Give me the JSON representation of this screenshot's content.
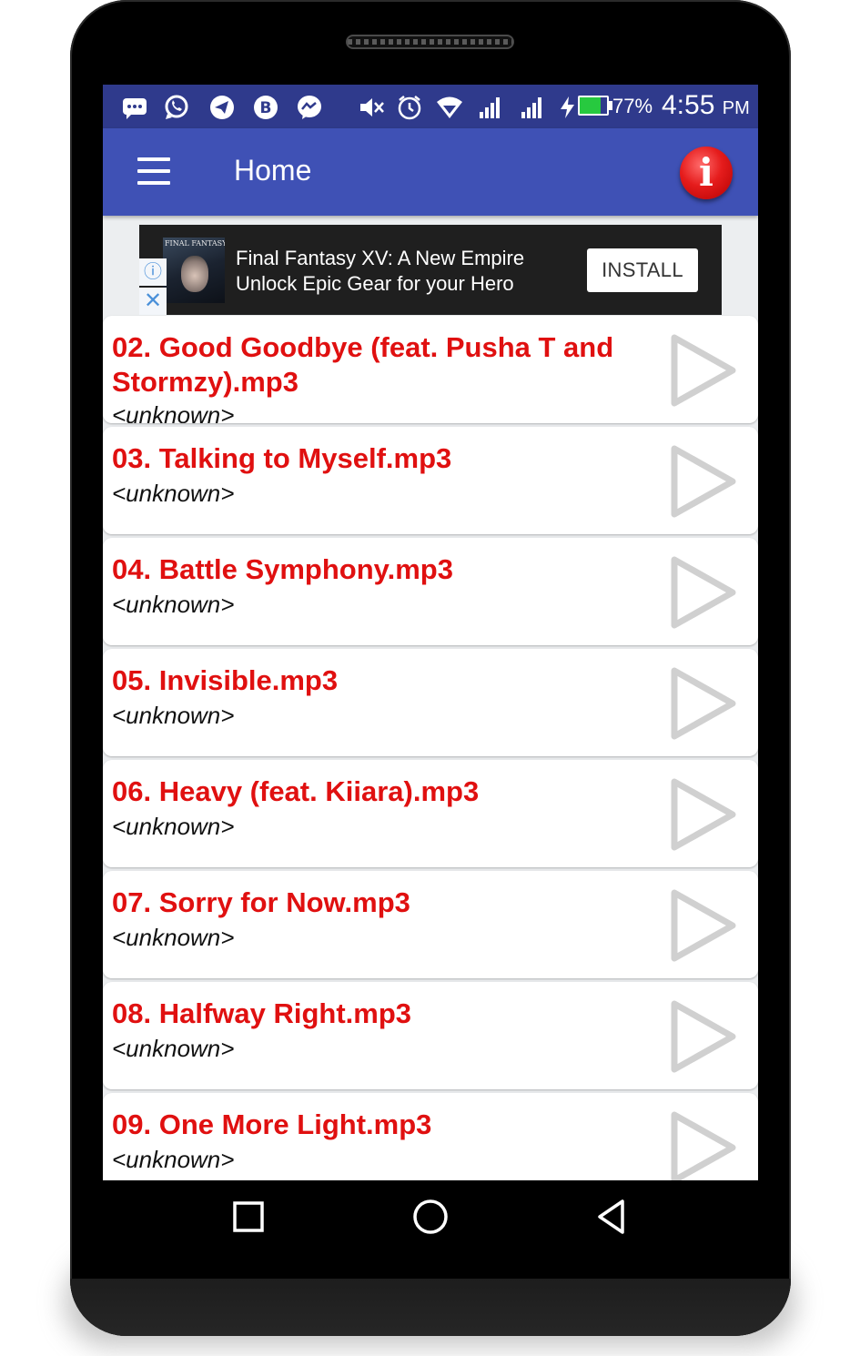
{
  "status_bar": {
    "icons": [
      "messaging-icon",
      "whatsapp-icon",
      "telegram-icon",
      "bbm-icon",
      "messenger-icon",
      "mute-icon",
      "alarm-icon",
      "wifi-icon",
      "signal-icon",
      "signal-icon",
      "charging-icon",
      "battery-icon"
    ],
    "battery_percent": "77%",
    "battery_level": 0.77,
    "time": "4:55",
    "ampm": "PM"
  },
  "app_bar": {
    "title": "Home",
    "menu_icon": "hamburger-menu-icon",
    "info_icon": "info-icon",
    "info_glyph": "i",
    "accent_color": "#3f51b5",
    "status_color": "#2f3a8c"
  },
  "ad": {
    "thumb_title": "FINAL FANTASY XV",
    "line1": "Final Fantasy XV: A New Empire",
    "line2": "Unlock Epic Gear for your Hero",
    "install_label": "INSTALL",
    "info_glyph": "ⓘ",
    "close_glyph": "✕"
  },
  "tracks": [
    {
      "title": "02. Good Goodbye (feat. Pusha T and Stormzy).mp3",
      "artist": "<unknown>"
    },
    {
      "title": "03. Talking to Myself.mp3",
      "artist": "<unknown>"
    },
    {
      "title": "04. Battle Symphony.mp3",
      "artist": "<unknown>"
    },
    {
      "title": "05. Invisible.mp3",
      "artist": "<unknown>"
    },
    {
      "title": "06. Heavy (feat. Kiiara).mp3",
      "artist": "<unknown>"
    },
    {
      "title": "07. Sorry for Now.mp3",
      "artist": "<unknown>"
    },
    {
      "title": "08. Halfway Right.mp3",
      "artist": "<unknown>"
    },
    {
      "title": "09. One More Light.mp3",
      "artist": "<unknown>"
    }
  ],
  "colors": {
    "track_title": "#e01010",
    "play_icon": "#d0d0d0"
  },
  "nav_bar": {
    "icons": [
      "recent-apps-icon",
      "home-icon",
      "back-icon"
    ]
  }
}
